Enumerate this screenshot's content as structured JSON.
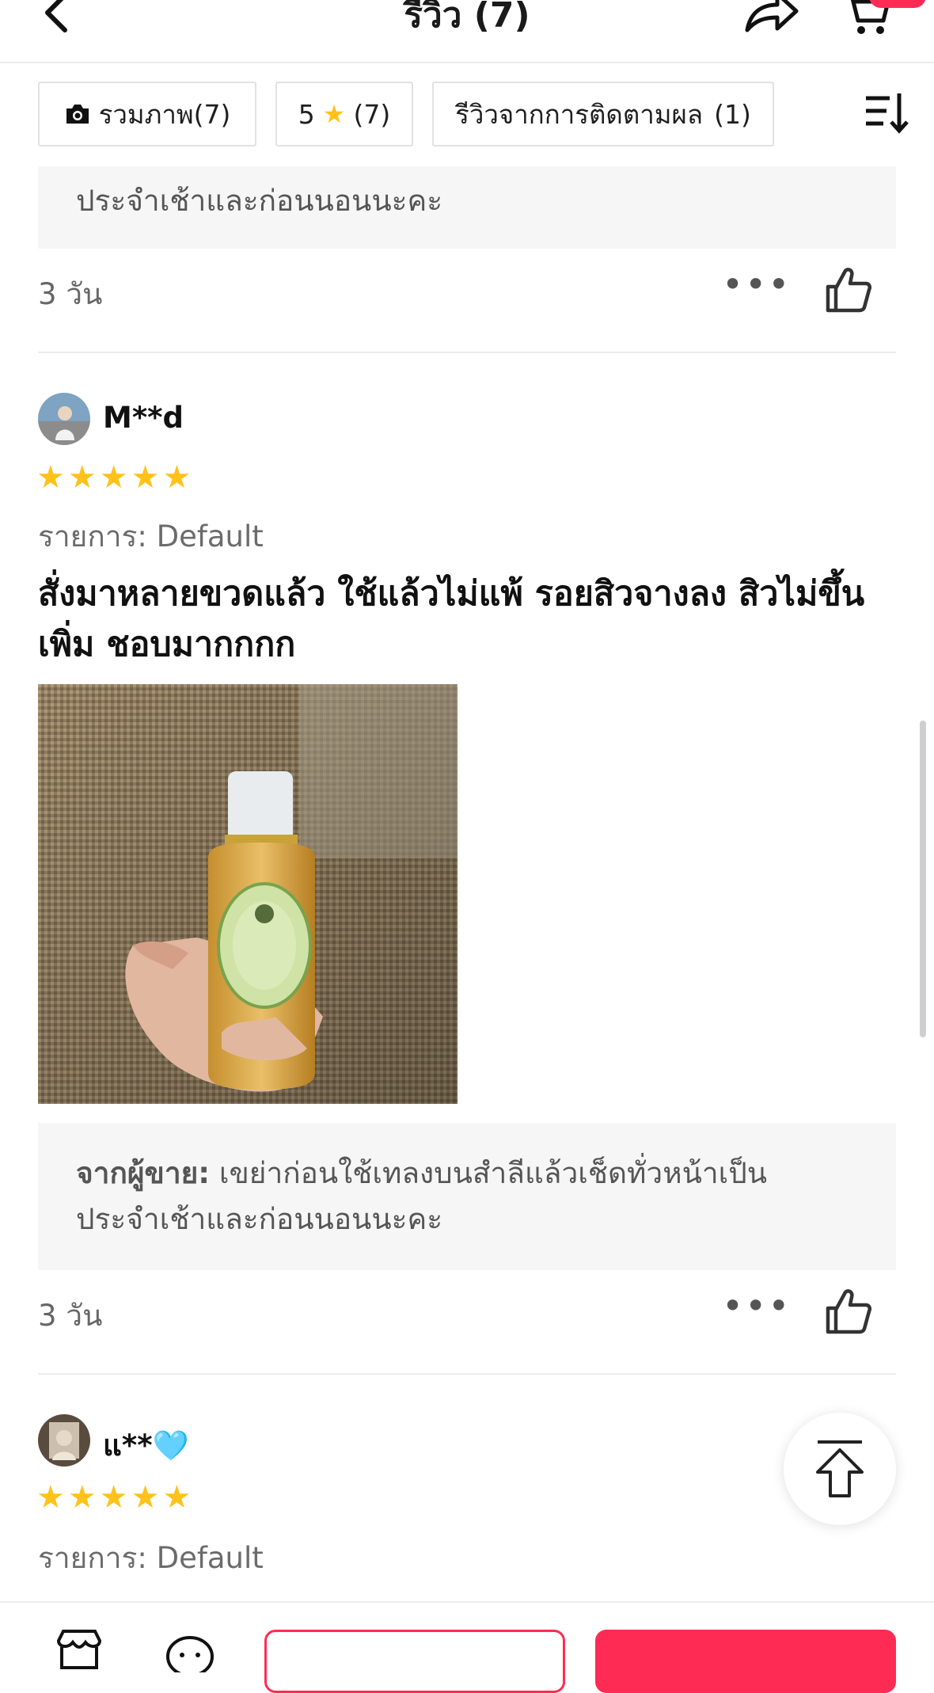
{
  "header": {
    "title": "รีวิว (7)"
  },
  "filters": {
    "photos_label": "รวมภาพ(7)",
    "rating_value": "5",
    "rating_count": "(7)",
    "followup_label": "รีวิวจากการติดตามผล",
    "followup_count": "(1)"
  },
  "reviews": [
    {
      "seller_reply_tail": "ประจำเช้าและก่อนนอนนะคะ",
      "time": "3 วัน"
    },
    {
      "username": "M**d",
      "stars": "★★★★★",
      "variant": "รายการ: Default",
      "text_line1": "สั่งมาหลายขวดแล้ว ใช้แล้วไม่แพ้ รอยสิวจางลง สิวไม่ขึ้น",
      "text_line2": "เพิ่ม ชอบมากกกก",
      "seller_label": "จากผู้ขาย:",
      "seller_line1": "เขย่าก่อนใช้เทลงบนสำลีแล้วเช็ดทั่วหน้าเป็น",
      "seller_line2": "ประจำเช้าและก่อนนอนนะคะ",
      "time": "3 วัน"
    },
    {
      "username": "แ**🩵",
      "stars": "★★★★★",
      "variant": "รายการ: Default"
    }
  ],
  "icons": {
    "back": "chevron-left-icon",
    "share": "share-arrow-icon",
    "cart": "shopping-cart-icon",
    "camera": "camera-icon",
    "sort": "sort-icon",
    "more": "more-dots-icon",
    "like": "thumbs-up-icon",
    "scroll_top": "arrow-up-icon",
    "shop": "shop-icon",
    "chat": "chat-icon"
  },
  "colors": {
    "accent": "#fe2c55",
    "star": "#ffc21a",
    "seller_box_bg": "#f6f6f7"
  }
}
